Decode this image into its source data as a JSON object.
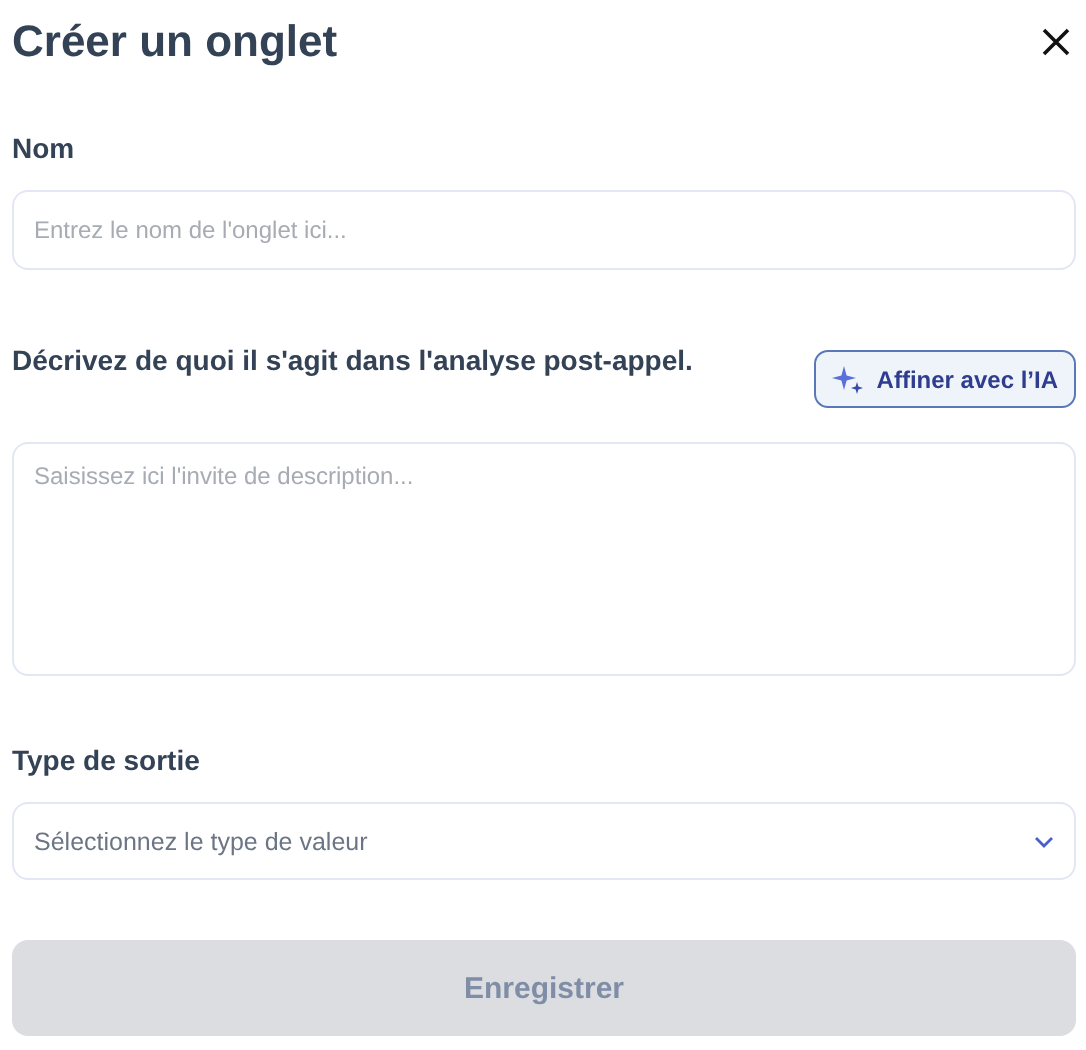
{
  "dialog": {
    "title": "Créer un onglet"
  },
  "name_field": {
    "label": "Nom",
    "placeholder": "Entrez le nom de l'onglet ici..."
  },
  "description_field": {
    "label": "Décrivez de quoi il s'agit dans l'analyse post-appel.",
    "placeholder": "Saisissez ici l'invite de description..."
  },
  "ai_button": {
    "label": "Affiner avec l’IA"
  },
  "output_type": {
    "label": "Type de sortie",
    "placeholder": "Sélectionnez le type de valeur"
  },
  "save_button": {
    "label": "Enregistrer",
    "disabled": true
  }
}
